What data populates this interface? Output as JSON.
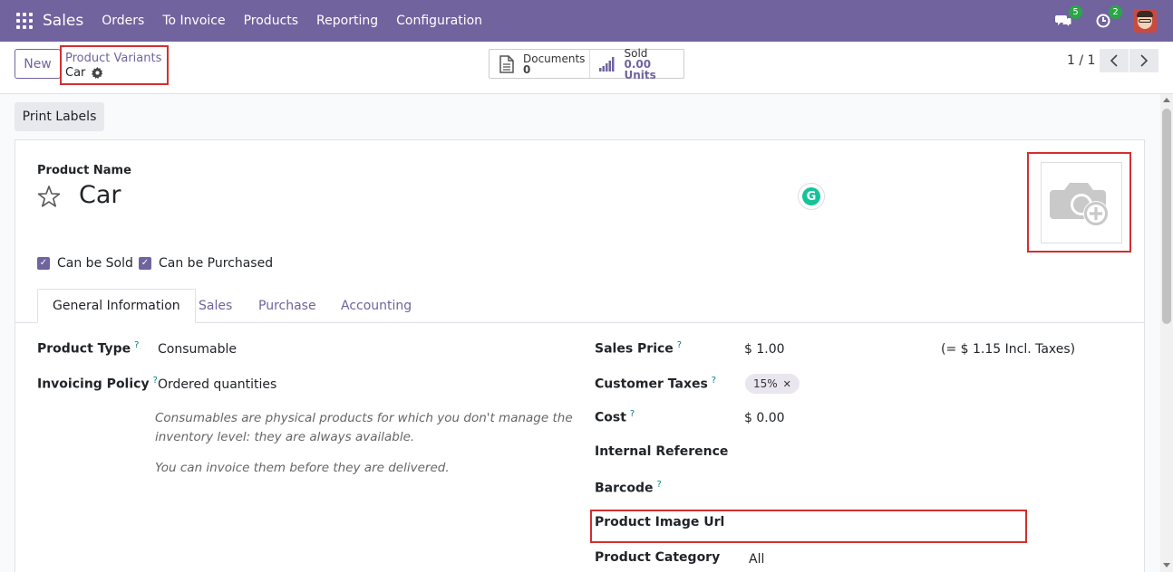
{
  "navbar": {
    "app_name": "Sales",
    "menu": [
      "Orders",
      "To Invoice",
      "Products",
      "Reporting",
      "Configuration"
    ],
    "messages_badge": "5",
    "activities_badge": "2"
  },
  "control": {
    "new_label": "New",
    "breadcrumb_parent": "Product Variants",
    "breadcrumb_current": "Car",
    "smart_buttons": {
      "documents_label": "Documents",
      "documents_value": "0",
      "sold_label": "Sold",
      "sold_value": "0.00 Units"
    },
    "pager": "1 / 1"
  },
  "actions": {
    "print_labels": "Print Labels"
  },
  "form": {
    "name_label": "Product Name",
    "name_value": "Car",
    "can_be_sold": "Can be Sold",
    "can_be_purchased": "Can be Purchased",
    "tabs": [
      "General Information",
      "Sales",
      "Purchase",
      "Accounting"
    ],
    "left": {
      "product_type_label": "Product Type",
      "product_type_value": "Consumable",
      "invoicing_policy_label": "Invoicing Policy",
      "invoicing_policy_value": "Ordered quantities",
      "help_line1": "Consumables are physical products for which you don't manage the",
      "help_line2": "inventory level: they are always available.",
      "help_line3": "You can invoice them before they are delivered."
    },
    "right": {
      "sales_price_label": "Sales Price",
      "sales_price_value": "$ 1.00",
      "incl_taxes": "(= $ 1.15 Incl. Taxes)",
      "customer_taxes_label": "Customer Taxes",
      "customer_taxes_tag": "15%",
      "cost_label": "Cost",
      "cost_value": "$ 0.00",
      "internal_reference_label": "Internal Reference",
      "barcode_label": "Barcode",
      "product_image_url_label": "Product Image Url",
      "product_category_label": "Product Category",
      "product_category_value": "All"
    },
    "help_mark": "?"
  },
  "colors": {
    "brand": "#71639e",
    "highlight": "#d32f2f",
    "badge": "#28a745",
    "help": "#017e84"
  }
}
